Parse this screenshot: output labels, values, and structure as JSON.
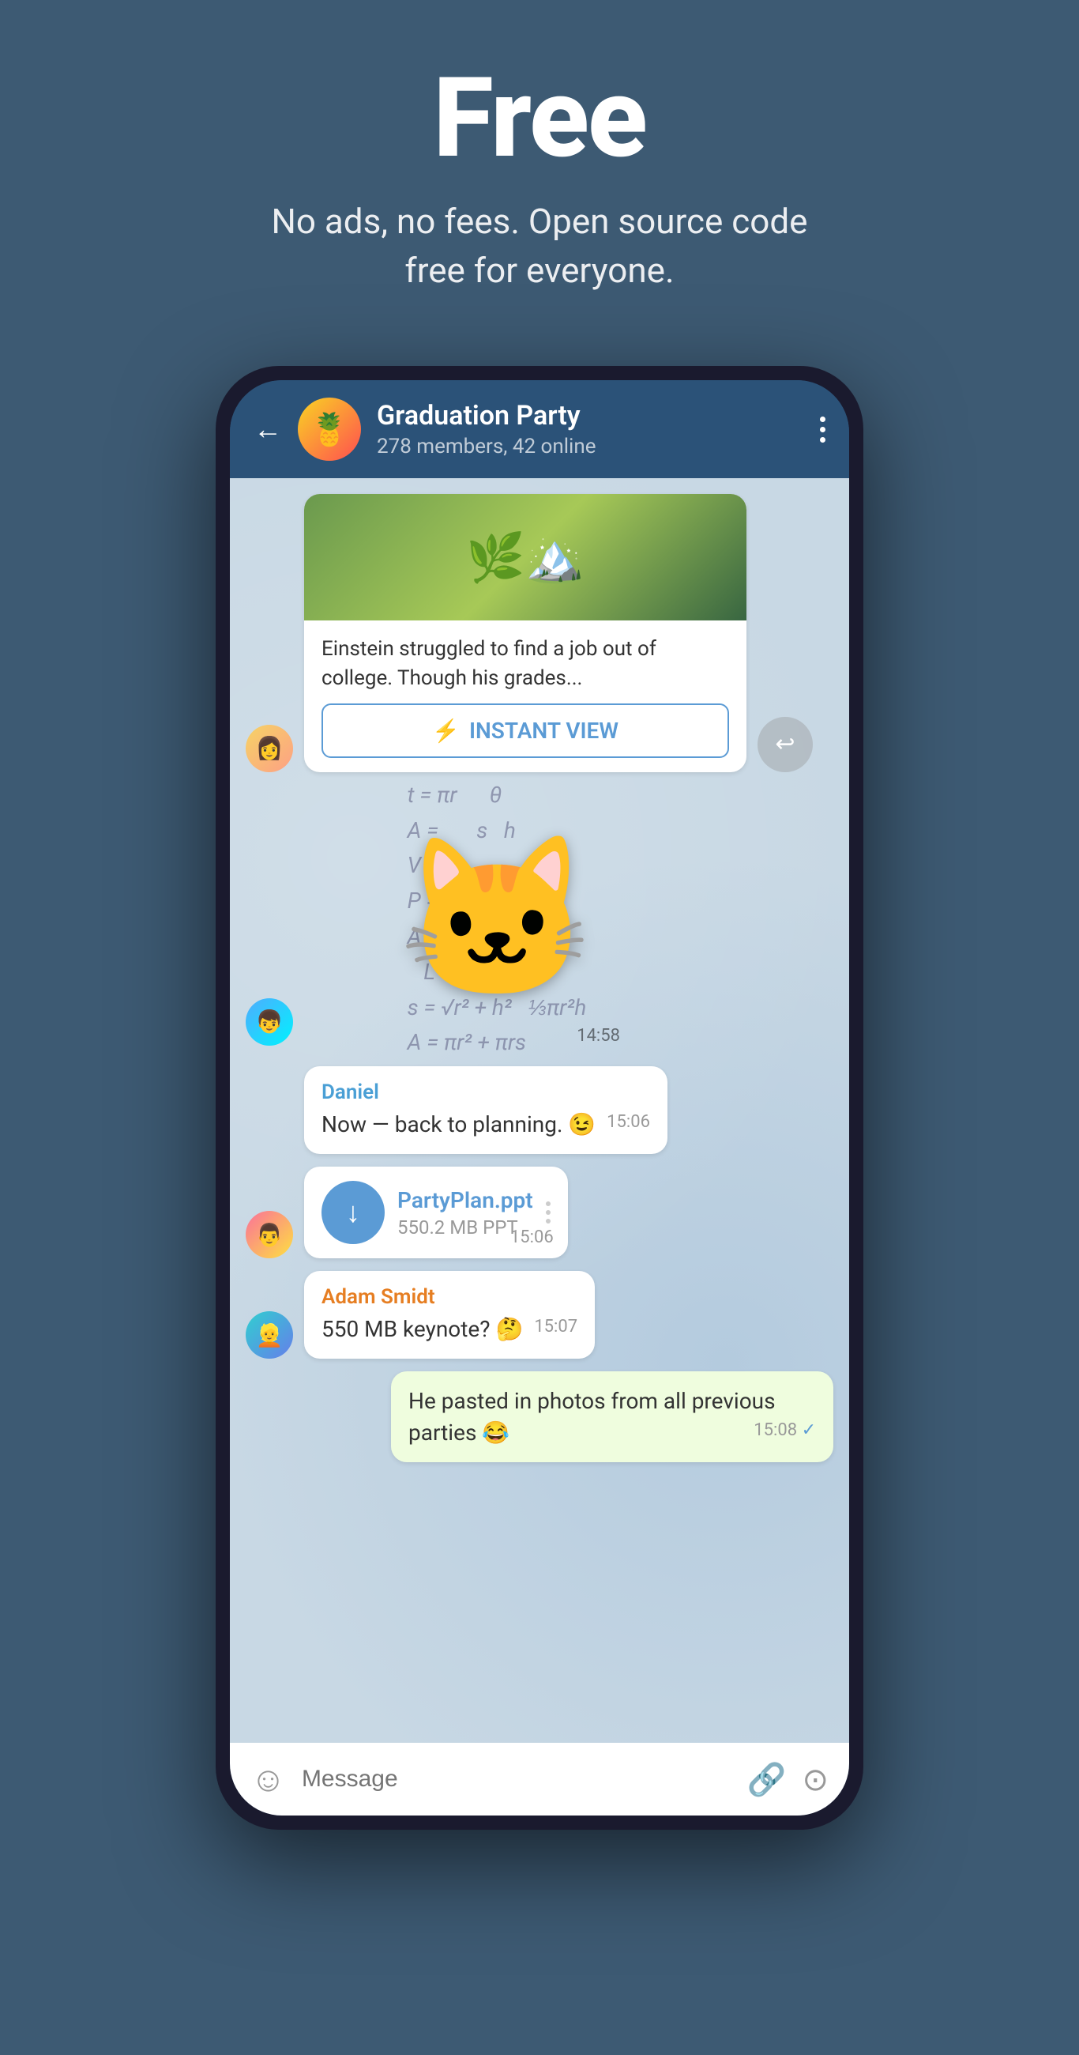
{
  "hero": {
    "title": "Free",
    "subtitle": "No ads, no fees. Open source code free for everyone."
  },
  "chat": {
    "back_label": "←",
    "group_name": "Graduation Party",
    "group_meta": "278 members, 42 online",
    "more_label": "⋮"
  },
  "messages": [
    {
      "id": "article-msg",
      "type": "article",
      "text": "Einstein struggled to find a job out of college. Though his grades...",
      "instant_view_label": "INSTANT VIEW",
      "time": ""
    },
    {
      "id": "sticker-msg",
      "type": "sticker",
      "time": "14:58"
    },
    {
      "id": "daniel-msg",
      "type": "received",
      "sender": "Daniel",
      "text": "Now — back to planning. 😉",
      "time": "15:06"
    },
    {
      "id": "file-msg",
      "type": "file",
      "file_name": "PartyPlan.ppt",
      "file_size": "550.2 MB PPT",
      "time": "15:06"
    },
    {
      "id": "adam-msg",
      "type": "received",
      "sender": "Adam Smidt",
      "text": "550 MB keynote? 🤔",
      "time": "15:07"
    },
    {
      "id": "sent-msg",
      "type": "sent",
      "text": "He pasted in photos from all previous parties 😂",
      "time": "15:08",
      "checkmark": "✓"
    }
  ],
  "input_bar": {
    "placeholder": "Message",
    "emoji_icon": "☺",
    "attach_icon": "📎",
    "camera_icon": "📷"
  },
  "math_formulas": [
    "t = πr²",
    "A =",
    "V = l³",
    "P = 2πr",
    "A = πr²",
    "s = √r² + h²",
    "A = πr² + πrs"
  ]
}
